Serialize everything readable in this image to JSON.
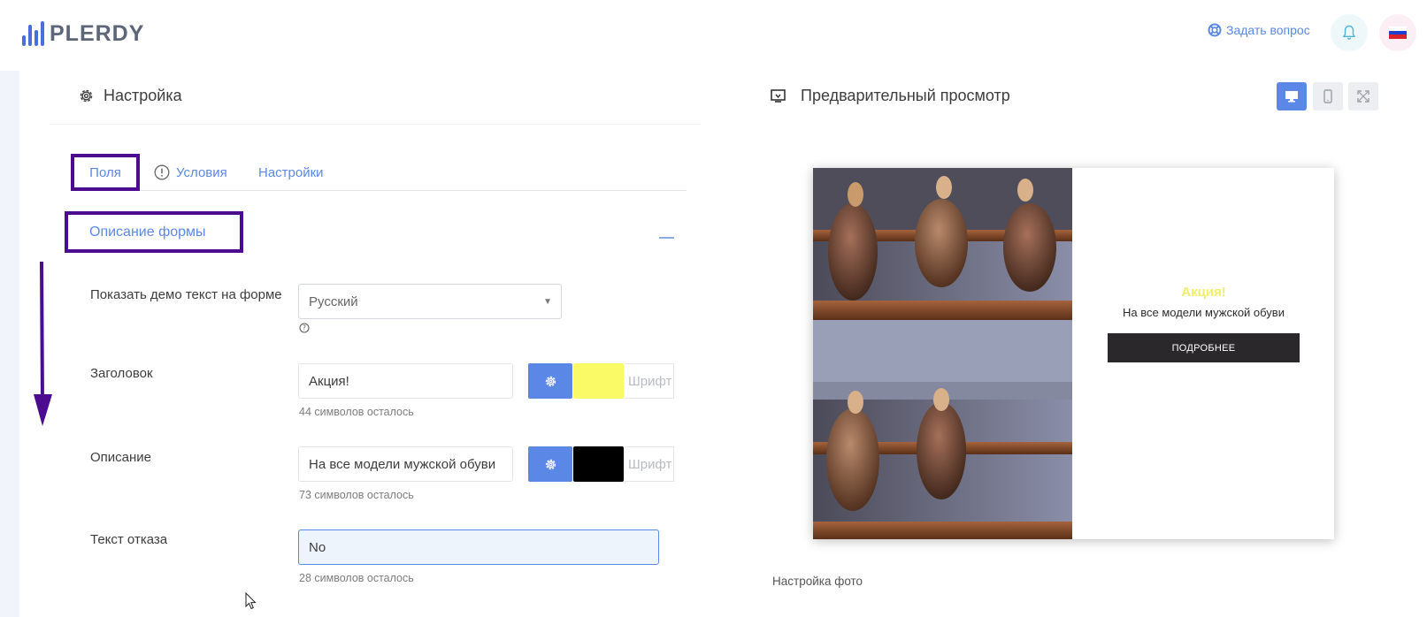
{
  "header": {
    "logo_text": "PLERDY",
    "ask_label": "Задать вопрос",
    "accent": "#5b87e6"
  },
  "settings": {
    "title": "Настройка",
    "tabs": [
      {
        "label": "Поля",
        "active": true
      },
      {
        "label": "Условия",
        "active": false
      },
      {
        "label": "Настройки",
        "active": false
      }
    ],
    "section_title": "Описание формы",
    "fields": {
      "demo": {
        "label": "Показать демо текст на форме",
        "value": "Русский"
      },
      "title": {
        "label": "Заголовок",
        "value": "Акция!",
        "hint": "44 символов осталось",
        "color": "#fafa66",
        "font_placeholder": "Шрифт"
      },
      "description": {
        "label": "Описание",
        "value": "На все модели мужской обуви",
        "hint": "73 символов осталось",
        "color": "#000000",
        "font_placeholder": "Шрифт"
      },
      "refusal": {
        "label": "Текст отказа",
        "value": "No",
        "hint": "28 символов осталось"
      }
    },
    "highlight_color": "#4b0c8f"
  },
  "preview": {
    "title": "Предварительный просмотр",
    "popup": {
      "title": "Акция!",
      "description": "На все модели мужской обуви",
      "button": "ПОДРОБНЕЕ"
    },
    "photo_settings_label": "Настройка фото"
  }
}
